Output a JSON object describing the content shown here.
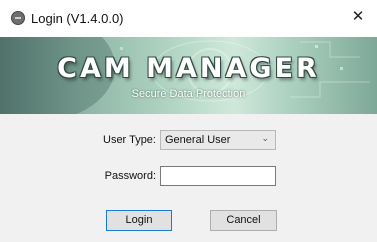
{
  "window": {
    "title": "Login (V1.4.0.0)",
    "close_glyph": "✕",
    "icon": "app-icon"
  },
  "banner": {
    "title": "CAM MANAGER",
    "subtitle": "Secure Data Protection"
  },
  "form": {
    "user_type_label": "User Type:",
    "user_type_value": "General User",
    "password_label": "Password:",
    "password_value": ""
  },
  "buttons": {
    "login": "Login",
    "cancel": "Cancel"
  },
  "colors": {
    "focus_border": "#1a7ad4",
    "banner_green": "#8db6a6"
  }
}
